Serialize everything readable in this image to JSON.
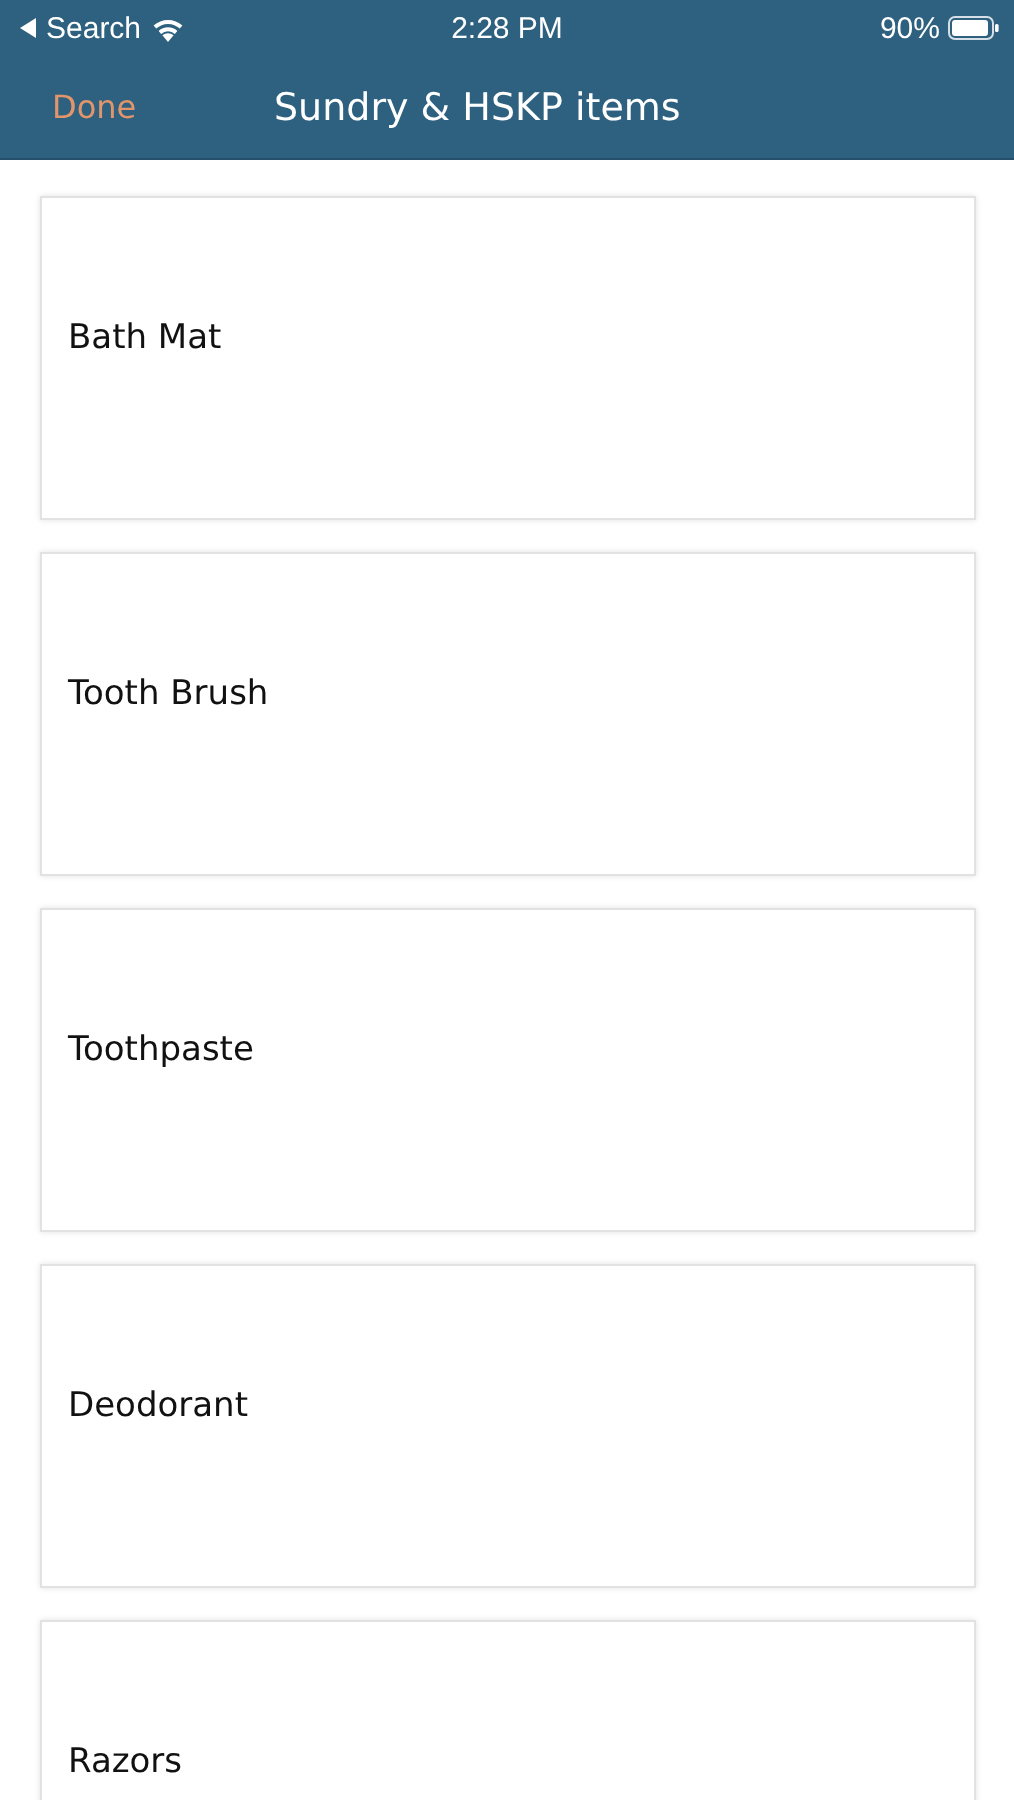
{
  "status_bar": {
    "back_label": "Search",
    "time": "2:28 PM",
    "battery": "90%"
  },
  "nav_bar": {
    "title": "Sundry & HSKP items",
    "done_button": {
      "label": "Done",
      "disabled": true
    }
  },
  "items": [
    {
      "label": "Bath Mat"
    },
    {
      "label": "Tooth Brush"
    },
    {
      "label": "Toothpaste"
    },
    {
      "label": "Deodorant"
    },
    {
      "label": "Razors"
    }
  ]
}
